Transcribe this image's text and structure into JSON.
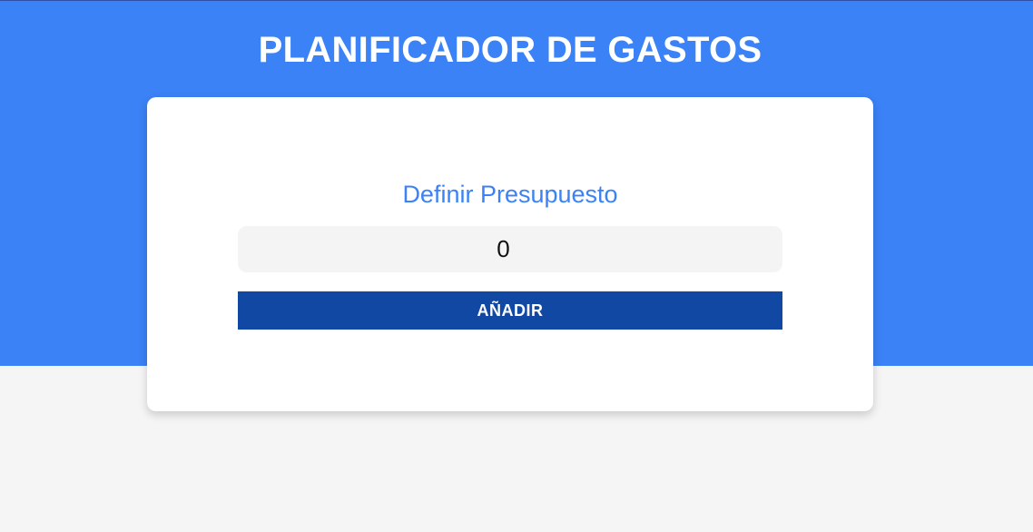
{
  "header": {
    "title": "PLANIFICADOR DE GASTOS"
  },
  "budget_form": {
    "heading": "Definir Presupuesto",
    "input_value": "0",
    "submit_label": "AÑADIR"
  },
  "colors": {
    "header_background": "#3b82f6",
    "page_background": "#f5f5f5",
    "heading_text": "#3b82f6",
    "button_background": "#1048a3",
    "input_background": "#f4f4f4"
  }
}
